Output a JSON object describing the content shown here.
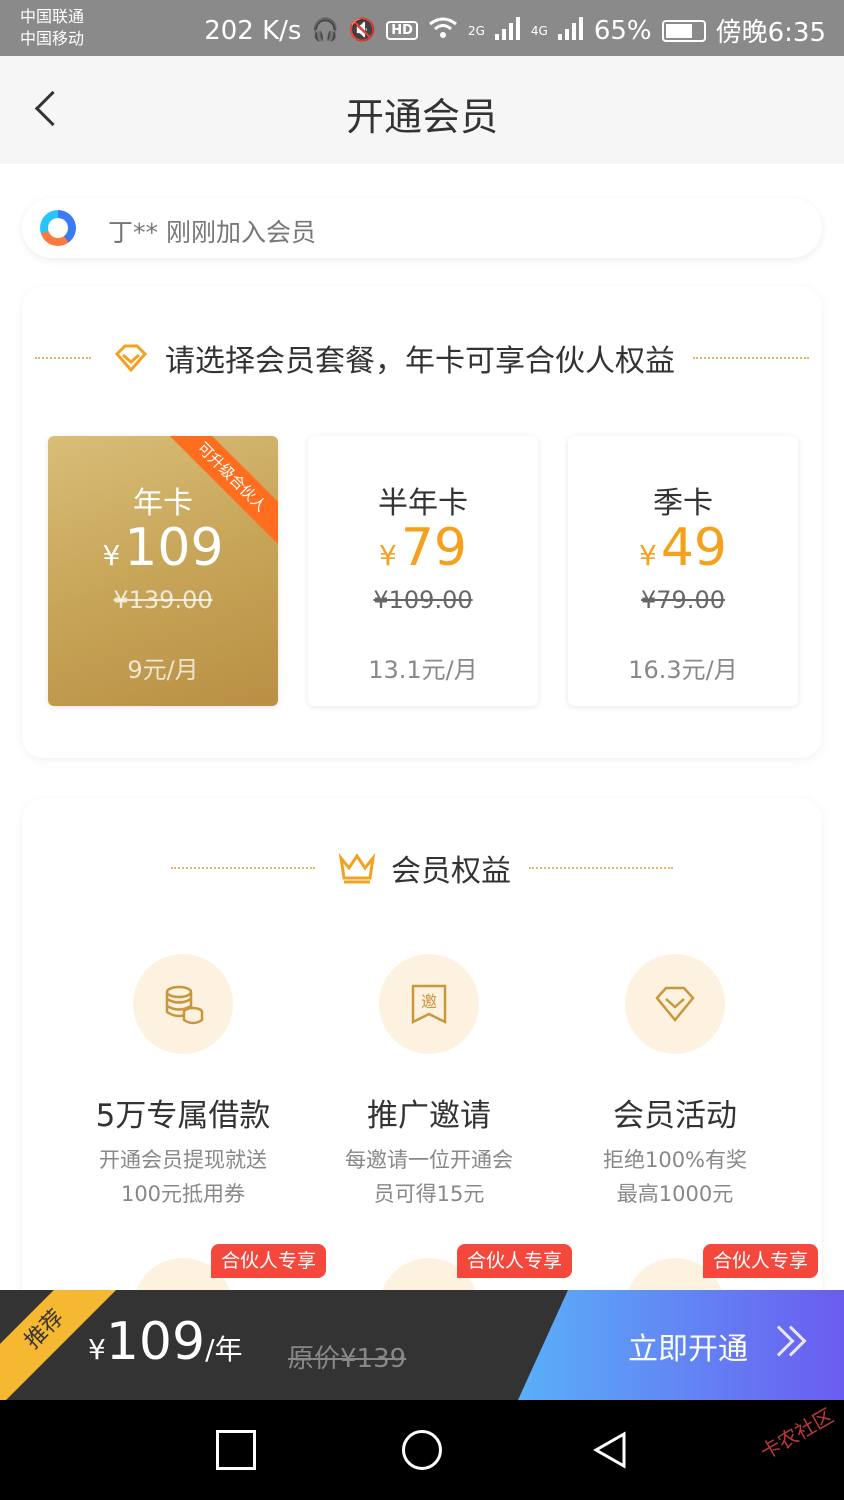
{
  "status_bar": {
    "carrier1": "中国联通",
    "carrier2": "中国移动",
    "speed": "202 K/s",
    "signal1": "2G",
    "signal2": "4G",
    "battery": "65%",
    "time": "傍晚6:35",
    "icons": [
      "headphones-icon",
      "mute-icon",
      "hd-icon",
      "wifi-icon",
      "signal-icon",
      "battery-icon"
    ]
  },
  "nav": {
    "title": "开通会员"
  },
  "notice": {
    "text": "丁** 刚刚加入会员"
  },
  "plans_section": {
    "title": "请选择会员套餐，年卡可享合伙人权益",
    "plans": [
      {
        "name": "年卡",
        "yen": "¥",
        "price": "109",
        "original": "¥139.00",
        "monthly": "9元/月",
        "ribbon": "可升级合伙人",
        "selected": true
      },
      {
        "name": "半年卡",
        "yen": "¥",
        "price": "79",
        "original": "¥109.00",
        "monthly": "13.1元/月",
        "selected": false
      },
      {
        "name": "季卡",
        "yen": "¥",
        "price": "49",
        "original": "¥79.00",
        "monthly": "16.3元/月",
        "selected": false
      }
    ]
  },
  "benefits_section": {
    "title": "会员权益",
    "items": [
      {
        "title": "5万专属借款",
        "desc1": "开通会员提现就送",
        "desc2": "100元抵用券",
        "icon": "coins-icon"
      },
      {
        "title": "推广邀请",
        "desc1": "每邀请一位开通会",
        "desc2": "员可得15元",
        "icon": "invite-icon"
      },
      {
        "title": "会员活动",
        "desc1": "拒绝100%有奖",
        "desc2": "最高1000元",
        "icon": "diamond-icon"
      }
    ],
    "partner_tag": "合伙人专享"
  },
  "action_bar": {
    "badge": "推荐",
    "yen": "¥",
    "price": "109",
    "unit": "/年",
    "original": "原价¥139",
    "button": "立即开通"
  },
  "watermark": "卡农社区",
  "colors": {
    "gold": "#f3a11e",
    "accent_orange": "#ff6d1f",
    "tag_red": "#f5483d",
    "button_blue": "#5ab0f8",
    "button_purple": "#6a5cf0"
  }
}
